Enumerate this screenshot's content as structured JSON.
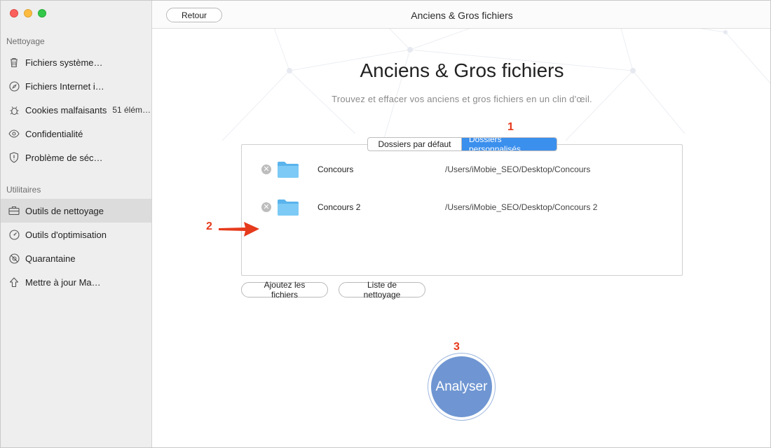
{
  "sidebar": {
    "sections": [
      {
        "heading": "Nettoyage",
        "items": [
          {
            "label": "Fichiers système…",
            "icon": "trash-icon"
          },
          {
            "label": "Fichiers Internet i…",
            "icon": "compass-icon"
          },
          {
            "label": "Cookies malfaisants",
            "count": "51 élém…",
            "icon": "bug-icon"
          },
          {
            "label": "Confidentialité",
            "icon": "eye-icon"
          },
          {
            "label": "Problème de séc…",
            "icon": "shield-icon"
          }
        ]
      },
      {
        "heading": "Utilitaires",
        "items": [
          {
            "label": "Outils de nettoyage",
            "icon": "toolbox-icon",
            "selected": true
          },
          {
            "label": "Outils d'optimisation",
            "icon": "gauge-icon"
          },
          {
            "label": "Quarantaine",
            "icon": "quarantine-icon"
          },
          {
            "label": "Mettre à jour Ma…",
            "icon": "arrow-up-icon"
          }
        ]
      }
    ]
  },
  "toolbar": {
    "back_label": "Retour",
    "title": "Anciens & Gros fichiers"
  },
  "main": {
    "title": "Anciens & Gros fichiers",
    "subtitle": "Trouvez et effacer vos anciens et gros fichiers en un clin d'œil.",
    "segmented": {
      "default_label": "Dossiers par défaut",
      "custom_label": "Dossiers personnalisés",
      "active": "custom"
    },
    "folders": [
      {
        "name": "Concours",
        "path": "/Users/iMobie_SEO/Desktop/Concours"
      },
      {
        "name": "Concours 2",
        "path": "/Users/iMobie_SEO/Desktop/Concours 2"
      }
    ],
    "add_files_label": "Ajoutez les fichiers",
    "clean_list_label": "Liste de nettoyage",
    "analyze_label": "Analyser"
  },
  "annotations": {
    "step1": "1",
    "step2": "2",
    "step3": "3"
  },
  "colors": {
    "accent": "#3b8fed",
    "analyze": "#6f96d2",
    "annotation": "#e63a1c",
    "folder": "#5ab4ec"
  }
}
